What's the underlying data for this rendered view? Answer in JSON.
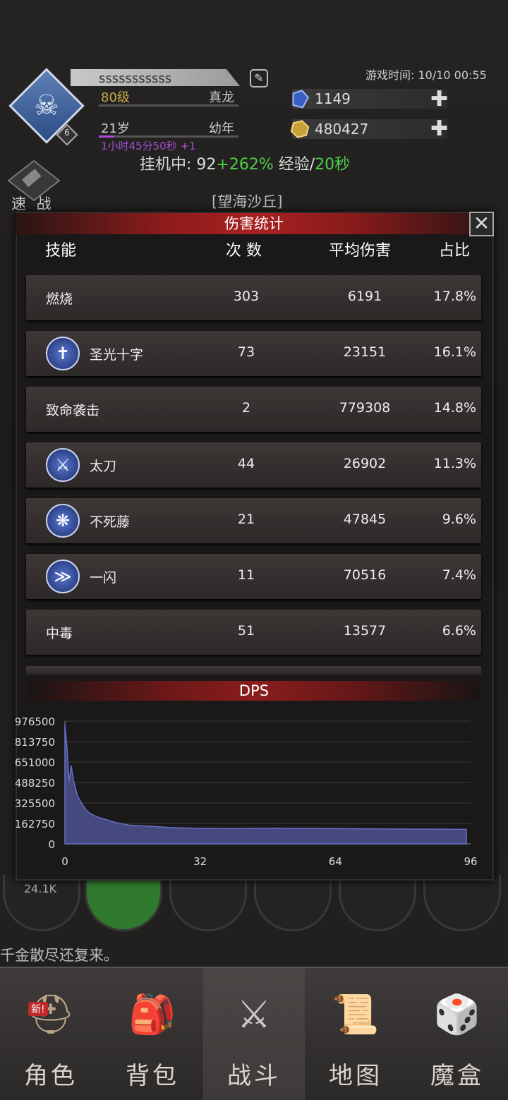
{
  "header": {
    "player_name": "sssssssssss",
    "level": "80级",
    "title": "真龙",
    "age": "21岁",
    "age_stage": "幼年",
    "time_remaining": "1小时45分50秒 +1",
    "badge_level": "6",
    "game_time": "游戏时间: 10/10 00:55",
    "diamonds": "1149",
    "gold": "480427",
    "afk_label": "挂机中: ",
    "afk_base": "92",
    "afk_bonus": "+262%",
    "afk_exp_label": " 经验/",
    "afk_interval": "20秒",
    "quick_battle": "速 战",
    "map_name": "[望海沙丘]"
  },
  "modal": {
    "title": "伤害统计",
    "close": "✕",
    "columns": [
      "技能",
      "次 数",
      "平均伤害",
      "占比"
    ],
    "rows": [
      {
        "name": "燃烧",
        "count": "303",
        "avg": "6191",
        "pct": "17.8%",
        "icon": ""
      },
      {
        "name": "圣光十字",
        "count": "73",
        "avg": "23151",
        "pct": "16.1%",
        "icon": "cross-icon"
      },
      {
        "name": "致命袭击",
        "count": "2",
        "avg": "779308",
        "pct": "14.8%",
        "icon": ""
      },
      {
        "name": "太刀",
        "count": "44",
        "avg": "26902",
        "pct": "11.3%",
        "icon": "sword-icon"
      },
      {
        "name": "不死藤",
        "count": "21",
        "avg": "47845",
        "pct": "9.6%",
        "icon": "vine-icon"
      },
      {
        "name": "一闪",
        "count": "11",
        "avg": "70516",
        "pct": "7.4%",
        "icon": "flash-icon"
      },
      {
        "name": "中毒",
        "count": "51",
        "avg": "13577",
        "pct": "6.6%",
        "icon": ""
      }
    ]
  },
  "chart_data": {
    "type": "area",
    "title": "DPS",
    "x_ticks": [
      "0",
      "32",
      "64",
      "96"
    ],
    "y_ticks": [
      "976500",
      "813750",
      "651000",
      "488250",
      "325500",
      "162750",
      "0"
    ],
    "xlim": [
      0,
      96
    ],
    "ylim": [
      0,
      976500
    ],
    "x": [
      0,
      0.5,
      1,
      1.5,
      2,
      3,
      4,
      5,
      6,
      8,
      10,
      12,
      15,
      20,
      25,
      30,
      40,
      50,
      60,
      70,
      80,
      90,
      95
    ],
    "y": [
      950000,
      760000,
      500000,
      620000,
      510000,
      380000,
      320000,
      270000,
      240000,
      210000,
      190000,
      170000,
      150000,
      140000,
      130000,
      125000,
      122000,
      125000,
      123000,
      120000,
      118000,
      117000,
      115000
    ],
    "color": "#6670c8"
  },
  "skillbar": {
    "hp_text": "24.1K"
  },
  "ticker": "千金散尽还复来。",
  "nav": {
    "tabs": [
      {
        "label": "角色",
        "icon": "helmet-icon",
        "new": "新!"
      },
      {
        "label": "背包",
        "icon": "backpack-icon"
      },
      {
        "label": "战斗",
        "icon": "sword-shield-icon"
      },
      {
        "label": "地图",
        "icon": "scroll-icon"
      },
      {
        "label": "魔盒",
        "icon": "magic-box-icon"
      }
    ]
  }
}
